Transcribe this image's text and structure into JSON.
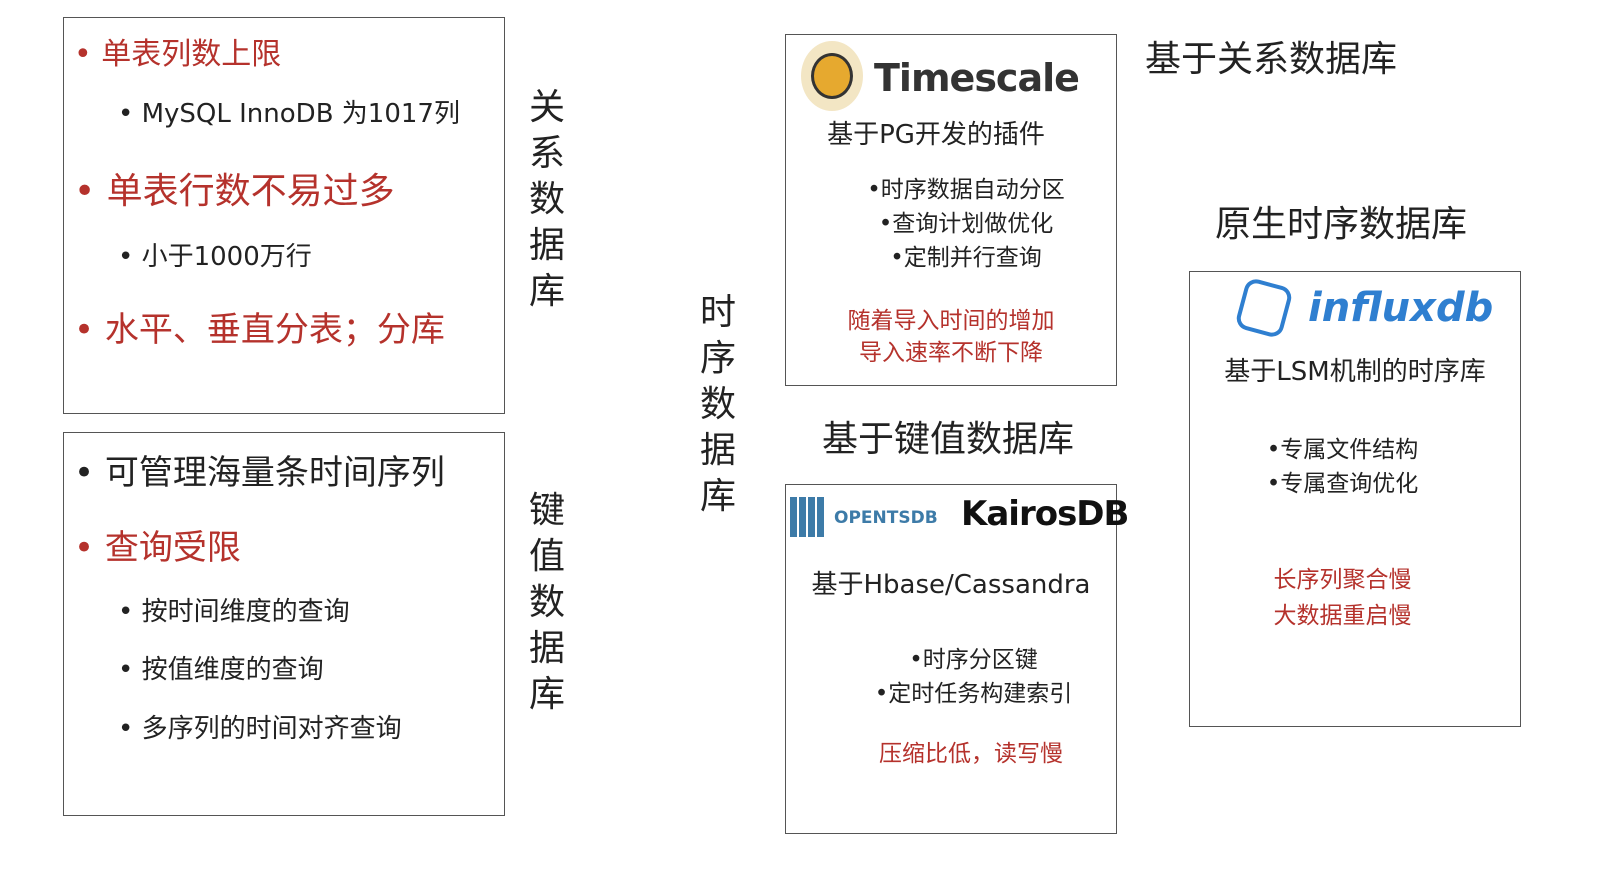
{
  "relational": {
    "label": "关系数据库",
    "items": [
      {
        "text": "• 单表列数上限",
        "level": 1,
        "color": "red"
      },
      {
        "text": "• MySQL InnoDB 为1017列",
        "level": 2,
        "color": "black"
      },
      {
        "text": "• 单表行数不易过多",
        "level": 1,
        "color": "red"
      },
      {
        "text": "• 小于1000万行",
        "level": 2,
        "color": "black"
      },
      {
        "text": "• 水平、垂直分表；分库",
        "level": 1,
        "color": "red"
      }
    ]
  },
  "keyvalue": {
    "label": "键值数据库",
    "items": [
      {
        "text": "• 可管理海量条时间序列",
        "level": 1,
        "color": "black"
      },
      {
        "text": "• 查询受限",
        "level": 1,
        "color": "red"
      },
      {
        "text": "• 按时间维度的查询",
        "level": 2,
        "color": "black"
      },
      {
        "text": "• 按值维度的查询",
        "level": 2,
        "color": "black"
      },
      {
        "text": "• 多序列的时间对齐查询",
        "level": 2,
        "color": "black"
      }
    ]
  },
  "tsdb_label": "时序数据库",
  "timescale": {
    "category": "基于关系数据库",
    "logo": "Timescale",
    "subtitle": "基于PG开发的插件",
    "features": [
      "•时序数据自动分区",
      "•查询计划做优化",
      "•定制并行查询"
    ],
    "drawbacks": [
      "随着导入时间的增加",
      "导入速率不断下降"
    ]
  },
  "kv_tsdb": {
    "category": "基于键值数据库",
    "logos": [
      "OPENTSDB",
      "KairosDB"
    ],
    "subtitle": "基于Hbase/Cassandra",
    "features": [
      "•时序分区键",
      "•定时任务构建索引"
    ],
    "drawbacks": [
      "压缩比低，读写慢"
    ]
  },
  "influx": {
    "category": "原生时序数据库",
    "logo": "influxdb",
    "subtitle": "基于LSM机制的时序库",
    "features": [
      "•专属文件结构",
      "•专属查询优化"
    ],
    "drawbacks": [
      "长序列聚合慢",
      "大数据重启慢"
    ]
  },
  "colors": {
    "red": "#b5322c",
    "border": "#555555",
    "influx": "#2f7fd0",
    "opentsdb_green": "#8cb83c",
    "opentsdb_blue": "#3d7ba8"
  }
}
